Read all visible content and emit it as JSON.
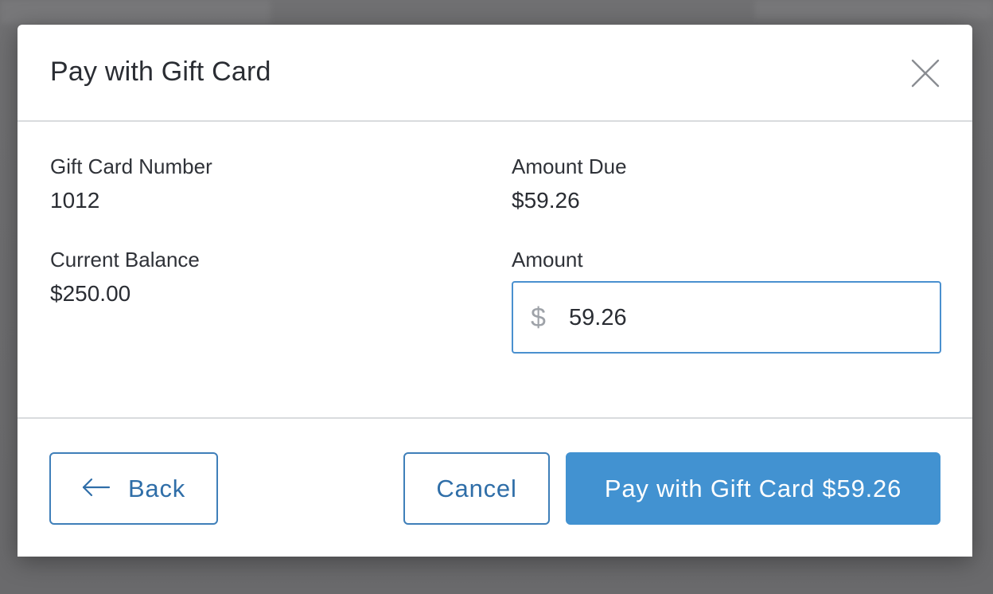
{
  "modal": {
    "title": "Pay with Gift Card",
    "close_icon": "close-icon"
  },
  "fields": {
    "gift_card_number": {
      "label": "Gift Card Number",
      "value": "1012"
    },
    "current_balance": {
      "label": "Current Balance",
      "value": "$250.00"
    },
    "amount_due": {
      "label": "Amount Due",
      "value": "$59.26"
    },
    "amount": {
      "label": "Amount",
      "currency_symbol": "$",
      "value": "59.26"
    }
  },
  "footer": {
    "back_label": "Back",
    "back_icon": "arrow-left-icon",
    "cancel_label": "Cancel",
    "pay_label": "Pay with Gift Card $59.26"
  },
  "colors": {
    "accent": "#4292d1",
    "accent_border": "#3f7fb9",
    "input_focus_border": "#4a90cf",
    "overlay": "#6f6f71"
  }
}
